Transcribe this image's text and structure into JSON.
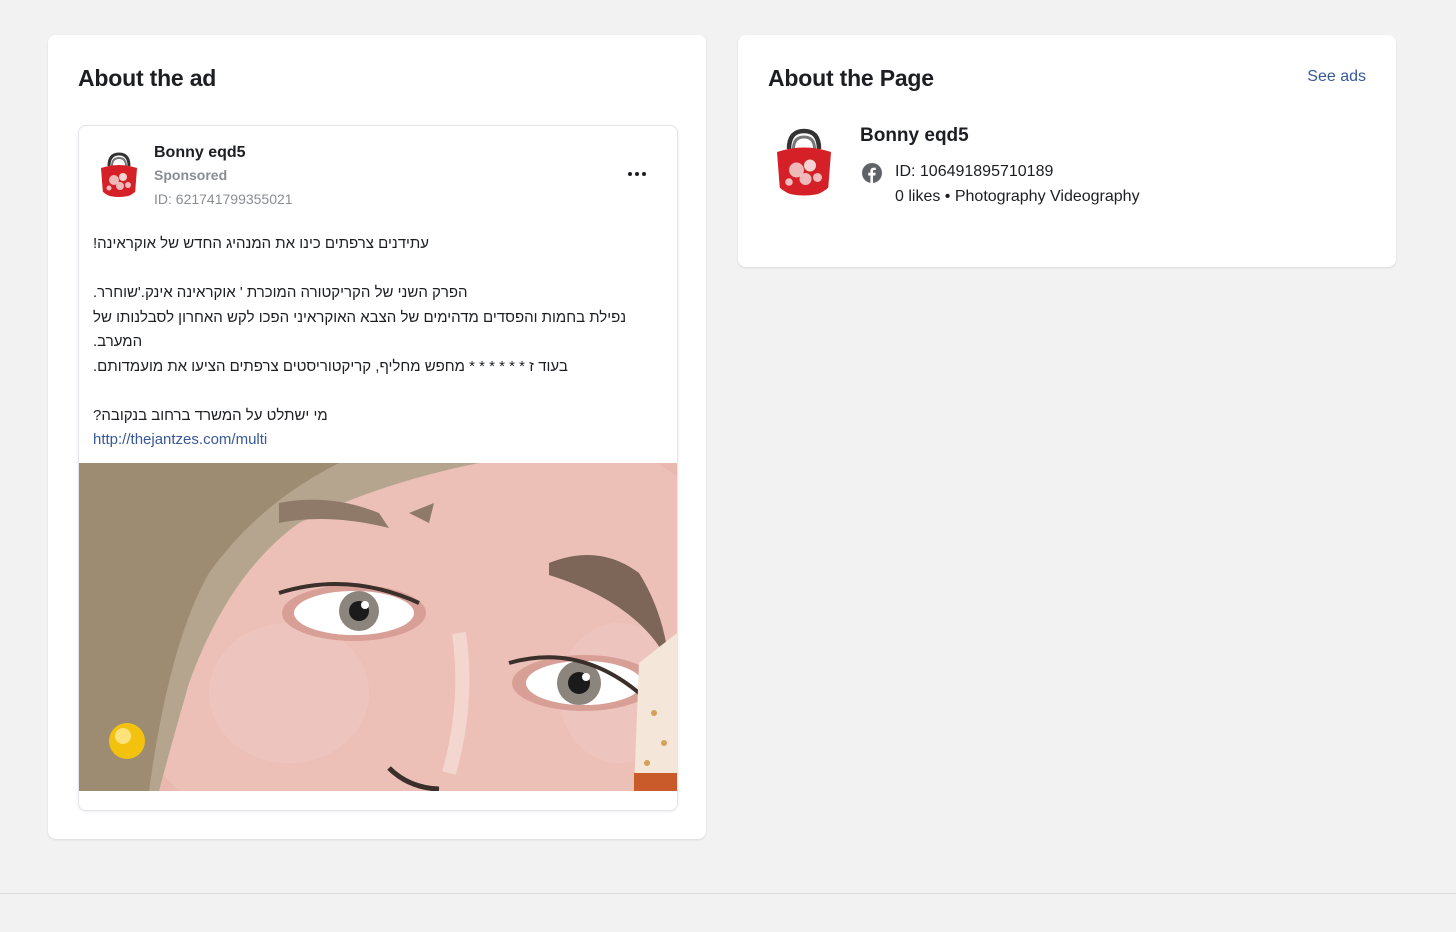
{
  "ad_section": {
    "title": "About the ad",
    "ad": {
      "advertiser_name": "Bonny eqd5",
      "sponsored_label": "Sponsored",
      "ad_id": "ID: 621741799355021",
      "more_icon": "more-horizontal-icon",
      "body_lines": [
        "עתידנים צרפתים כינו את המנהיג החדש של אוקראינה!",
        "",
        "הפרק השני של הקריקטורה המוכרת ' אוקראינה אינק.'שוחרר.",
        "נפילת בחמות והפסדים מדהימים של הצבא האוקראיני הפכו לקש האחרון לסבלנותו של המערב.",
        "בעוד ז * * * * * * מחפש מחליף, קריקטוריסטים צרפתים הציעו את מועמדותם.",
        "",
        "מי ישתלט על המשרד ברחוב בנקובה?"
      ],
      "link": "http://thejantzes.com/multi"
    }
  },
  "page_section": {
    "title": "About the Page",
    "see_ads_label": "See ads",
    "page_name": "Bonny eqd5",
    "platform_icon": "facebook-icon",
    "page_id": "ID: 106491895710189",
    "meta": "0 likes • Photography Videography"
  },
  "colors": {
    "background": "#f2f2f2",
    "card": "#ffffff",
    "link": "#385898",
    "muted_text": "#8a8d91",
    "avatar_red": "#d42026"
  }
}
